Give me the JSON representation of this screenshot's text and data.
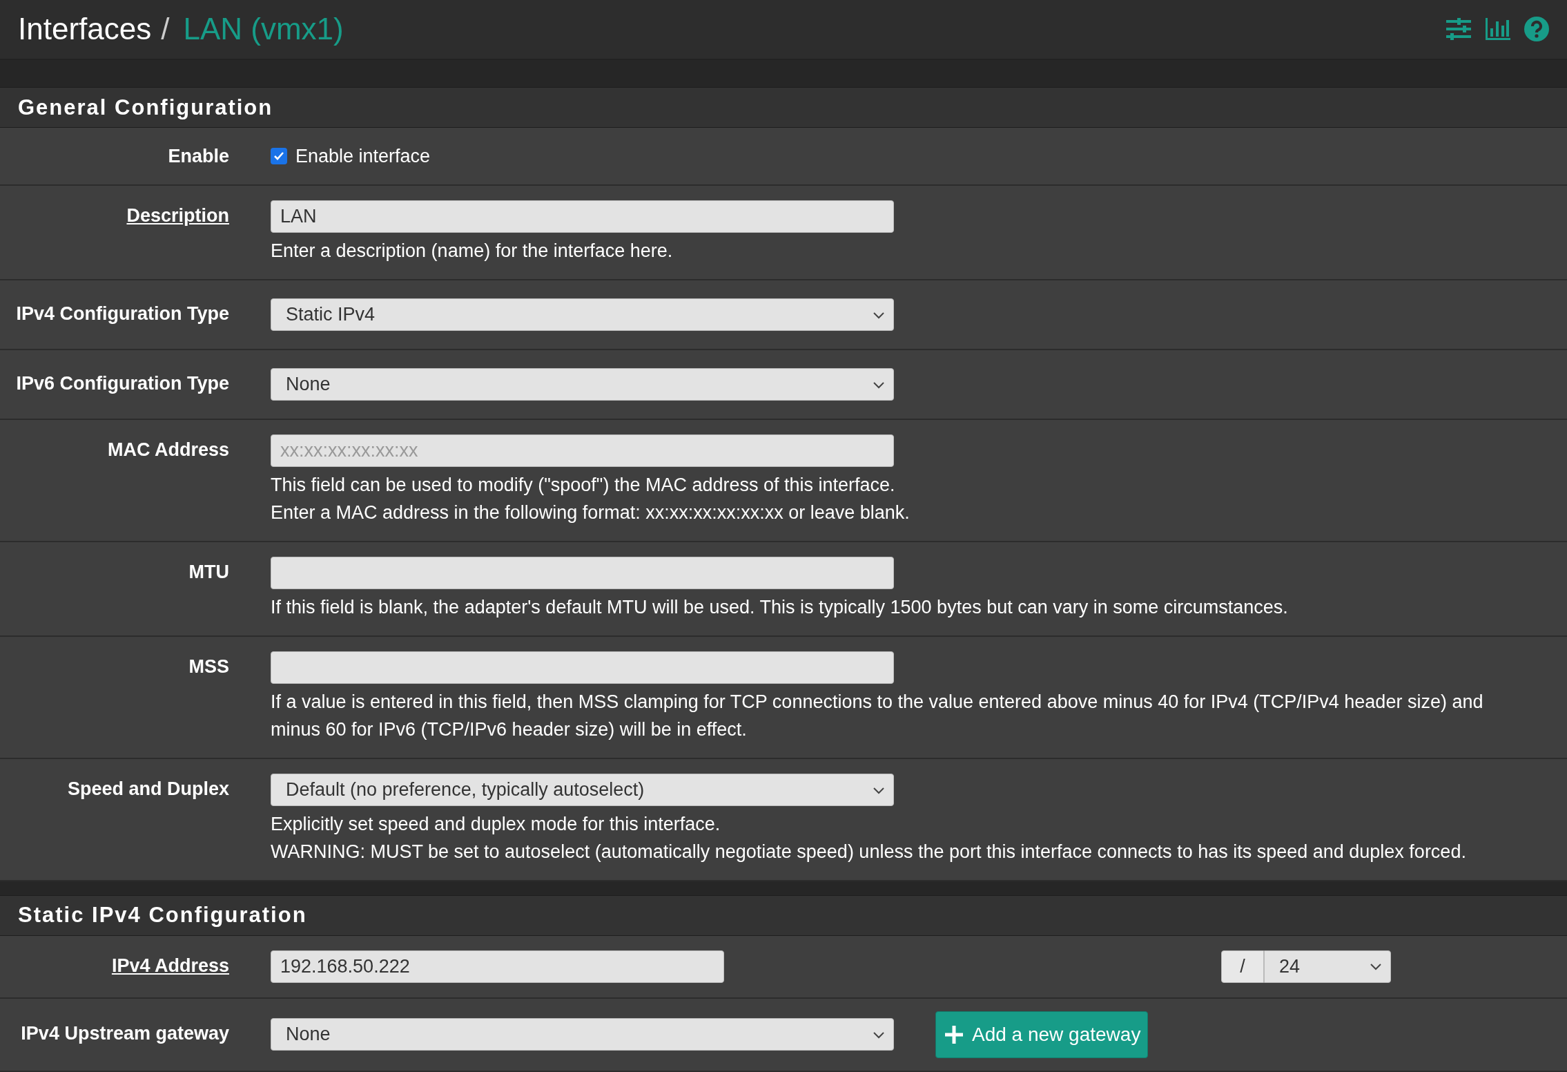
{
  "breadcrumb": {
    "parent": "Interfaces",
    "separator": "/",
    "current": "LAN (vmx1)"
  },
  "sections": [
    {
      "title": "General Configuration",
      "rows": [
        {
          "kind": "checkbox",
          "label": "Enable",
          "underlined": false,
          "checked": true,
          "text": "Enable interface"
        },
        {
          "kind": "text",
          "label": "Description",
          "underlined": true,
          "value": "LAN",
          "help": [
            "Enter a description (name) for the interface here."
          ]
        },
        {
          "kind": "select",
          "label": "IPv4 Configuration Type",
          "underlined": false,
          "value": "Static IPv4"
        },
        {
          "kind": "select",
          "label": "IPv6 Configuration Type",
          "underlined": false,
          "value": "None"
        },
        {
          "kind": "text",
          "label": "MAC Address",
          "underlined": false,
          "placeholder": "xx:xx:xx:xx:xx:xx",
          "help": [
            "This field can be used to modify (\"spoof\") the MAC address of this interface.",
            "Enter a MAC address in the following format: xx:xx:xx:xx:xx:xx or leave blank."
          ]
        },
        {
          "kind": "text",
          "label": "MTU",
          "underlined": false,
          "help": [
            "If this field is blank, the adapter's default MTU will be used. This is typically 1500 bytes but can vary in some circumstances."
          ]
        },
        {
          "kind": "text",
          "label": "MSS",
          "underlined": false,
          "help": [
            "If a value is entered in this field, then MSS clamping for TCP connections to the value entered above minus 40 for IPv4 (TCP/IPv4 header size) and minus 60 for IPv6 (TCP/IPv6 header size) will be in effect."
          ]
        },
        {
          "kind": "select",
          "label": "Speed and Duplex",
          "underlined": false,
          "value": "Default (no preference, typically autoselect)",
          "help": [
            "Explicitly set speed and duplex mode for this interface.",
            "WARNING: MUST be set to autoselect (automatically negotiate speed) unless the port this interface connects to has its speed and duplex forced."
          ]
        }
      ]
    },
    {
      "title": "Static IPv4 Configuration",
      "rows": [
        {
          "kind": "address",
          "label": "IPv4 Address",
          "underlined": true,
          "value": "192.168.50.222",
          "separator": "/",
          "prefix": "24"
        },
        {
          "kind": "gateway",
          "label": "IPv4 Upstream gateway",
          "underlined": false,
          "value": "None",
          "button": "Add a new gateway"
        }
      ]
    }
  ]
}
